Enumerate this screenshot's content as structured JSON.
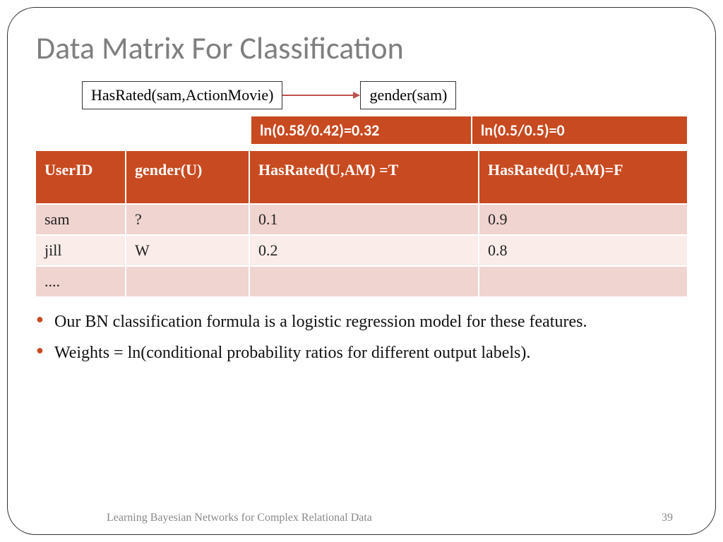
{
  "title": "Data Matrix For Classification",
  "diagram": {
    "left_box": "HasRated(sam,ActionMovie)",
    "right_box": "gender(sam)"
  },
  "formulas": {
    "left": "ln(0.58/0.42)=0.32",
    "right": "ln(0.5/0.5)=0"
  },
  "table": {
    "headers": {
      "c1": "UserID",
      "c2": "gender(U)",
      "c3": "HasRated(U,AM) =T",
      "c4": "HasRated(U,AM)=F"
    },
    "rows": [
      {
        "c1": "sam",
        "c2": "?",
        "c3": "0.1",
        "c4": "0.9"
      },
      {
        "c1": "jill",
        "c2": "W",
        "c3": "0.2",
        "c4": "0.8"
      },
      {
        "c1": "....",
        "c2": "",
        "c3": "",
        "c4": ""
      }
    ]
  },
  "bullets": {
    "b1": "Our BN classification formula is a logistic regression model for these features.",
    "b2": "Weights = ln(conditional probability ratios for different output labels)."
  },
  "footer": {
    "source": "Learning Bayesian Networks for Complex Relational Data",
    "page": "39"
  }
}
